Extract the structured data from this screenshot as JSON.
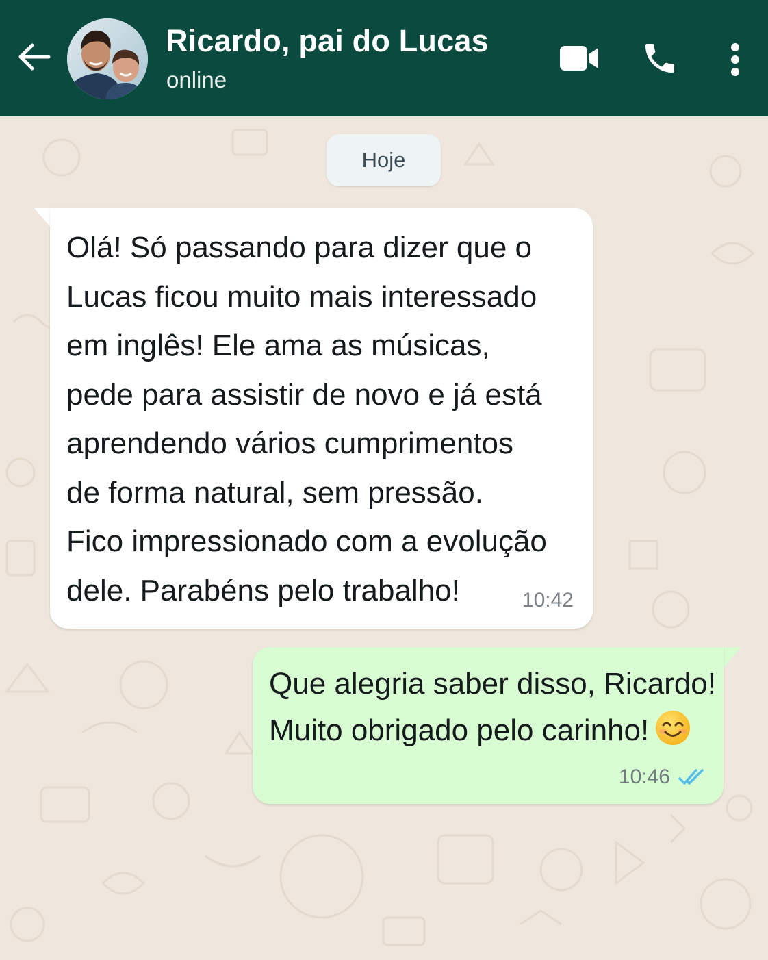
{
  "header": {
    "contact_name": "Ricardo, pai do Lucas",
    "status": "online",
    "avatar_icon": "avatar-photo-icon",
    "back_icon": "arrow-left-icon",
    "video_icon": "video-camera-icon",
    "call_icon": "phone-icon",
    "menu_icon": "more-vertical-icon",
    "background_color": "#0b4a3e"
  },
  "chat": {
    "date_label": "Hoje",
    "background_color": "#efe7dd",
    "messages": [
      {
        "direction": "incoming",
        "text": "Olá! Só passando para dizer que o\nLucas ficou muito mais interessado\nem inglês! Ele ama as músicas,\npede para assistir de novo e já está\naprendendo vários cumprimentos\nde forma natural, sem pressão.\nFico impressionado com a evolução\ndele. Parabéns pelo trabalho!",
        "time": "10:42",
        "bubble_color": "#ffffff"
      },
      {
        "direction": "outgoing",
        "line1": "Que alegria saber disso, Ricardo!",
        "line2": "Muito obrigado pelo carinho!",
        "emoji_icon": "smiling-face-emoji-icon",
        "time": "10:46",
        "receipt_icon": "double-check-read-icon",
        "bubble_color": "#d9fdd3",
        "receipt_color": "#53bdeb"
      }
    ]
  }
}
